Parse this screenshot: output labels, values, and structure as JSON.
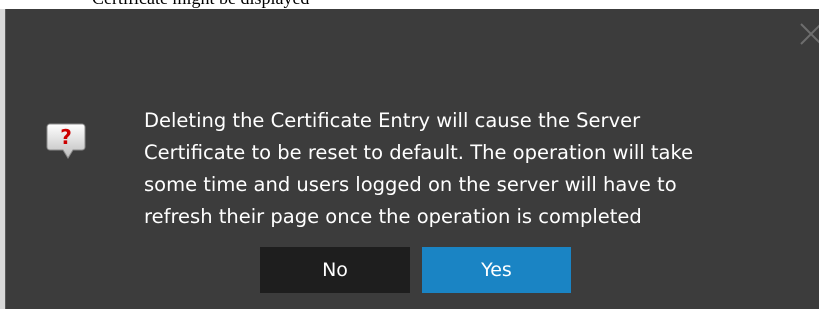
{
  "dialog": {
    "message_lines": [
      "Deleting the Certificate Entry will cause the Server",
      "Certificate to be reset to default. The operation will take",
      "some time and users logged on the server will have to",
      "refresh their page once the operation is completed"
    ],
    "buttons": {
      "no_label": "No",
      "yes_label": "Yes"
    },
    "icon": "question-icon",
    "close_icon": "close-icon"
  },
  "background_text": "Certificate might be displayed",
  "colors": {
    "dialog_background": "#3c3c3c",
    "no_button": "#1e1e1e",
    "yes_button": "#1a84c4",
    "question_mark": "#cc0000",
    "text": "#ffffff"
  }
}
